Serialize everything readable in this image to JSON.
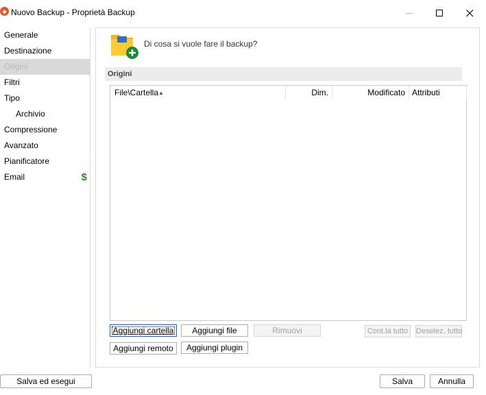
{
  "window": {
    "title": "Nuovo Backup - Proprietà Backup",
    "minimize_glyph": "—",
    "maximize_glyph": "☐",
    "close_glyph": "✕"
  },
  "sidebar": {
    "items": [
      {
        "label": "Generale"
      },
      {
        "label": "Destinazione"
      },
      {
        "label": "Origini"
      },
      {
        "label": "Filtri"
      },
      {
        "label": "Tipo"
      },
      {
        "label": "Archivio"
      },
      {
        "label": "Compressione"
      },
      {
        "label": "Avanzato"
      },
      {
        "label": "Pianificatore"
      },
      {
        "label": "Email"
      }
    ],
    "selected": "Origini",
    "email_badge": "$"
  },
  "main": {
    "question": "Di cosa si vuole fare il backup?",
    "section_title": "Origini",
    "columns": {
      "file": "File\\Cartella",
      "sort_indicator": "▲",
      "size": "Dim.",
      "modified": "Modificato",
      "attributes": "Attributi"
    },
    "rows": []
  },
  "buttons": {
    "add_folder": "Aggiungi cartella",
    "add_file": "Aggiungi file",
    "remove": "Rimuovi",
    "check_all": "Cont.la tutto",
    "deselect_all": "Deselez. tutto",
    "add_remote": "Aggiungi remoto",
    "add_plugin": "Aggiungi plugin",
    "save_and_run": "Salva ed esegui",
    "save": "Salva",
    "cancel": "Annulla"
  },
  "colors": {
    "app_icon": "#e8542a",
    "selected_bg": "#d9d9d9",
    "dollar": "#2e8b2e",
    "folder": "#f5b800",
    "plus_badge": "#1a8a3a",
    "focus_border": "#0a64d6"
  }
}
